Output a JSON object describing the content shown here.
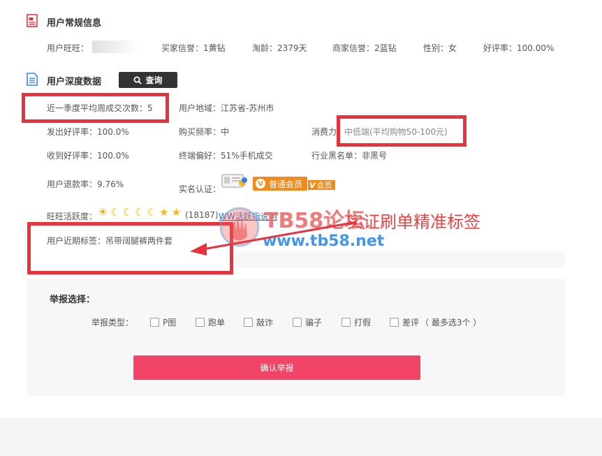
{
  "section1": {
    "title": "用户常规信息",
    "wangwang_label": "用户旺旺：",
    "buyer_credit": "买家信誉：1黄钻",
    "taobao_age": "淘龄：2379天",
    "seller_credit": "商家信誉：2蓝钻",
    "gender": "性别：女",
    "good_rate": "好评率：100.00%"
  },
  "section2": {
    "title": "用户深度数据",
    "query_button": "查询",
    "avg_weekly_trades": "近一季度平均周成交次数：5",
    "region": "用户地域：江苏省-苏州市",
    "send_good_rate": "发出好评率：100.0%",
    "buy_frequency": "购买频率：中",
    "spending_label": "消费力",
    "spending_value": "中低端(平均购物50-100元)",
    "receive_good_rate": "收到好评率：100.0%",
    "device_pref": "终端偏好：51%手机成交",
    "blacklist": "行业黑名单：非黑号",
    "refund_rate": "用户退款率：9.76%",
    "realname_label": "实名认证：",
    "vip_badge": "普通会员",
    "vip_badge2": "会员",
    "activity_label": "旺旺活跃度：",
    "activity_count": "(18187)",
    "activity_link": "WW活跃指说明",
    "recent_tags": "用户近期标签：吊带阔腿裤两件套"
  },
  "watermark": {
    "brand": "TB58论坛",
    "url": "www.tb58.net",
    "annotation": "实证刷单精准标签"
  },
  "report": {
    "title": "举报选择：",
    "type_label": "举报类型：",
    "options": [
      "P图",
      "跑单",
      "敲诈",
      "骗子",
      "打假",
      "差评"
    ],
    "note": "（ 最多选3个 ）",
    "confirm_button": "确认举报"
  },
  "colors": {
    "accent_red": "#e8333d",
    "button_pink": "#f24467",
    "badge_orange": "#f18c1c",
    "dark_button": "#333333"
  }
}
